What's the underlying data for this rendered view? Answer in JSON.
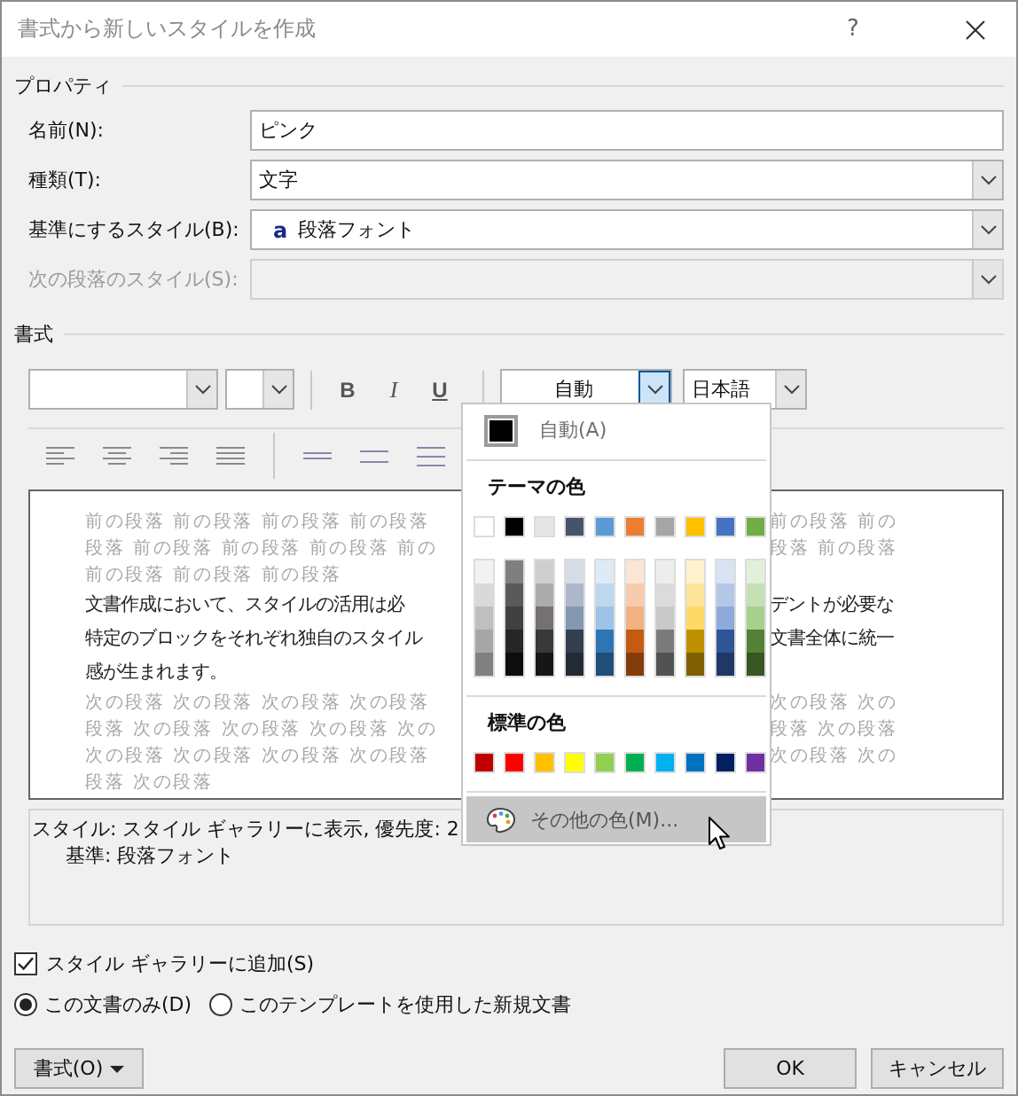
{
  "window": {
    "title": "書式から新しいスタイルを作成",
    "help": "?"
  },
  "properties": {
    "heading": "プロパティ",
    "fields": [
      {
        "label": "名前(N):",
        "kind": "text",
        "value": "ピンク",
        "disabled": false
      },
      {
        "label": "種類(T):",
        "kind": "combo",
        "value": "文字",
        "disabled": false
      },
      {
        "label": "基準にするスタイル(B):",
        "kind": "combo",
        "prefix": "a",
        "value": "段落フォント",
        "disabled": false
      },
      {
        "label": "次の段落のスタイル(S):",
        "kind": "combo",
        "disabled": true
      }
    ]
  },
  "formatting": {
    "heading": "書式",
    "bold": "B",
    "italic": "I",
    "underline": "U",
    "color": {
      "value": "自動",
      "expanded": true
    },
    "language": "日本語"
  },
  "preview": {
    "rows": [
      {
        "kind": "other",
        "left": "前の段落 前の段落 前の段落 前の段落",
        "right": "前の段落 前の"
      },
      {
        "kind": "other",
        "left": "段落 前の段落 前の段落 前の段落 前の",
        "right": "段落 前の段落"
      },
      {
        "kind": "other",
        "left": "前の段落 前の段落 前の段落"
      },
      {
        "kind": "sample",
        "left": "文書作成において、スタイルの活用は必",
        "right": "デントが必要な"
      },
      {
        "kind": "sample",
        "left": "特定のブロックをそれぞれ独自のスタイル",
        "right": "文書全体に統一"
      },
      {
        "kind": "sample",
        "left": "感が生まれます。"
      },
      {
        "kind": "other",
        "left": "次の段落 次の段落 次の段落 次の段落",
        "right": "次の段落 次の"
      },
      {
        "kind": "other",
        "left": "段落 次の段落 次の段落 次の段落 次の",
        "right": "段落 次の段落"
      },
      {
        "kind": "other",
        "left": "次の段落 次の段落 次の段落 次の段落",
        "right": "次の段落 次の"
      },
      {
        "kind": "other",
        "left": "段落 次の段落"
      }
    ]
  },
  "description": {
    "line": "スタイル: スタイル ギャラリーに表示, 優先度: 2",
    "detail": "基準: 段落フォント"
  },
  "add_to_gallery": {
    "label": "スタイル ギャラリーに追加(S)",
    "checked": true
  },
  "scope": [
    {
      "label": "この文書のみ(D)",
      "selected": true
    },
    {
      "label": "このテンプレートを使用した新規文書",
      "selected": false
    }
  ],
  "buttons": {
    "format": "書式(O)",
    "ok": "OK",
    "cancel": "キャンセル"
  },
  "color_menu": {
    "automatic": "自動(A)",
    "theme_heading": "テーマの色",
    "theme": [
      {
        "color": "#ffffff",
        "shades": [
          {
            "color": "#f2f2f2"
          },
          {
            "color": "#d9d9d9"
          },
          {
            "color": "#bfbfbf"
          },
          {
            "color": "#a6a6a6"
          },
          {
            "color": "#808080"
          }
        ]
      },
      {
        "color": "#000000",
        "shades": [
          {
            "color": "#7f7f7f"
          },
          {
            "color": "#595959"
          },
          {
            "color": "#404040"
          },
          {
            "color": "#262626"
          },
          {
            "color": "#0d0d0d"
          }
        ]
      },
      {
        "color": "#e7e6e6",
        "shades": [
          {
            "color": "#d0cece"
          },
          {
            "color": "#aeabab"
          },
          {
            "color": "#757171"
          },
          {
            "color": "#3b3838"
          },
          {
            "color": "#161616"
          }
        ]
      },
      {
        "color": "#44546a",
        "shades": [
          {
            "color": "#d6dce4"
          },
          {
            "color": "#adb9ca"
          },
          {
            "color": "#8497b0"
          },
          {
            "color": "#333f4f"
          },
          {
            "color": "#222a35"
          }
        ]
      },
      {
        "color": "#5b9bd5",
        "shades": [
          {
            "color": "#deebf6"
          },
          {
            "color": "#bdd7ee"
          },
          {
            "color": "#9dc3e6"
          },
          {
            "color": "#2e75b5"
          },
          {
            "color": "#1f4e79"
          }
        ]
      },
      {
        "color": "#ed7d31",
        "shades": [
          {
            "color": "#fbe5d5"
          },
          {
            "color": "#f7cbac"
          },
          {
            "color": "#f4b183"
          },
          {
            "color": "#c55a11"
          },
          {
            "color": "#843c0b"
          }
        ]
      },
      {
        "color": "#a5a5a5",
        "shades": [
          {
            "color": "#ededed"
          },
          {
            "color": "#dbdbdb"
          },
          {
            "color": "#c9c9c9"
          },
          {
            "color": "#7b7b7b"
          },
          {
            "color": "#525252"
          }
        ]
      },
      {
        "color": "#ffc000",
        "shades": [
          {
            "color": "#fff2cc"
          },
          {
            "color": "#fee599"
          },
          {
            "color": "#ffd965"
          },
          {
            "color": "#bf9000"
          },
          {
            "color": "#7f6000"
          }
        ]
      },
      {
        "color": "#4472c4",
        "shades": [
          {
            "color": "#dae3f3"
          },
          {
            "color": "#b4c7e7"
          },
          {
            "color": "#8faadc"
          },
          {
            "color": "#2f5597"
          },
          {
            "color": "#1f3864"
          }
        ]
      },
      {
        "color": "#70ad47",
        "shades": [
          {
            "color": "#e2efd9"
          },
          {
            "color": "#c5e0b3"
          },
          {
            "color": "#a8d08d"
          },
          {
            "color": "#538135"
          },
          {
            "color": "#375623"
          }
        ]
      }
    ],
    "standard_heading": "標準の色",
    "standard": [
      {
        "color": "#c00000"
      },
      {
        "color": "#ff0000"
      },
      {
        "color": "#ffc000"
      },
      {
        "color": "#ffff00"
      },
      {
        "color": "#92d050"
      },
      {
        "color": "#00b050"
      },
      {
        "color": "#00b0f0"
      },
      {
        "color": "#0070c0"
      },
      {
        "color": "#002060"
      },
      {
        "color": "#7030a0"
      }
    ],
    "more": {
      "label": "その他の色(M)...",
      "highlighted": true
    }
  }
}
